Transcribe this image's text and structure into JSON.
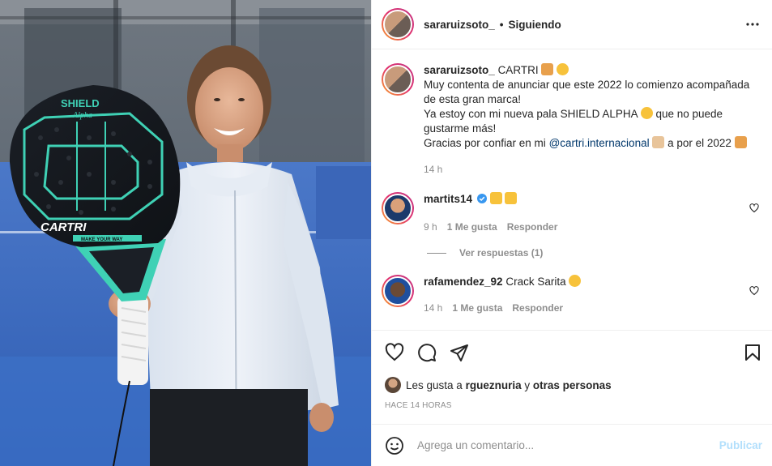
{
  "header": {
    "username": "sararuizsoto_",
    "separator": "•",
    "follow_status": "Siguiendo",
    "more_icon": "more-horizontal-icon"
  },
  "caption": {
    "username": "sararuizsoto_",
    "lines": [
      "CARTRI",
      "Muy contenta de anunciar que este 2022 lo comienzo acompañada de esta gran marca!",
      "Ya estoy con mi nueva pala SHIELD ALPHA",
      "que no puede gustarme más!",
      "Gracias por confiar en mi",
      "@cartri.internacional",
      "a por el 2022"
    ],
    "time": "14 h"
  },
  "comments": [
    {
      "username": "martits14",
      "verified": true,
      "text": "",
      "time": "9 h",
      "likes": "1 Me gusta",
      "reply": "Responder"
    },
    {
      "username": "rafamendez_92",
      "verified": false,
      "text": "Crack Sarita",
      "time": "14 h",
      "likes": "1 Me gusta",
      "reply": "Responder"
    }
  ],
  "view_replies": "Ver respuestas (1)",
  "likes_line": {
    "prefix": "Les gusta a",
    "user": "rgueznuria",
    "joiner": "y",
    "others": "otras personas"
  },
  "posted_ago": "HACE 14 HORAS",
  "add_comment": {
    "placeholder": "Agrega un comentario...",
    "publish": "Publicar"
  },
  "photo": {
    "paddle_brand": "CARTRI",
    "paddle_model": "SHIELD",
    "paddle_model_sub": "Alpha",
    "paddle_slogan": "MAKE YOUR WAY"
  },
  "colors": {
    "accent": "#0095f6",
    "publish_disabled": "#b2dffc",
    "verified": "#3897f0",
    "paddle_teal": "#3fd1b5"
  }
}
